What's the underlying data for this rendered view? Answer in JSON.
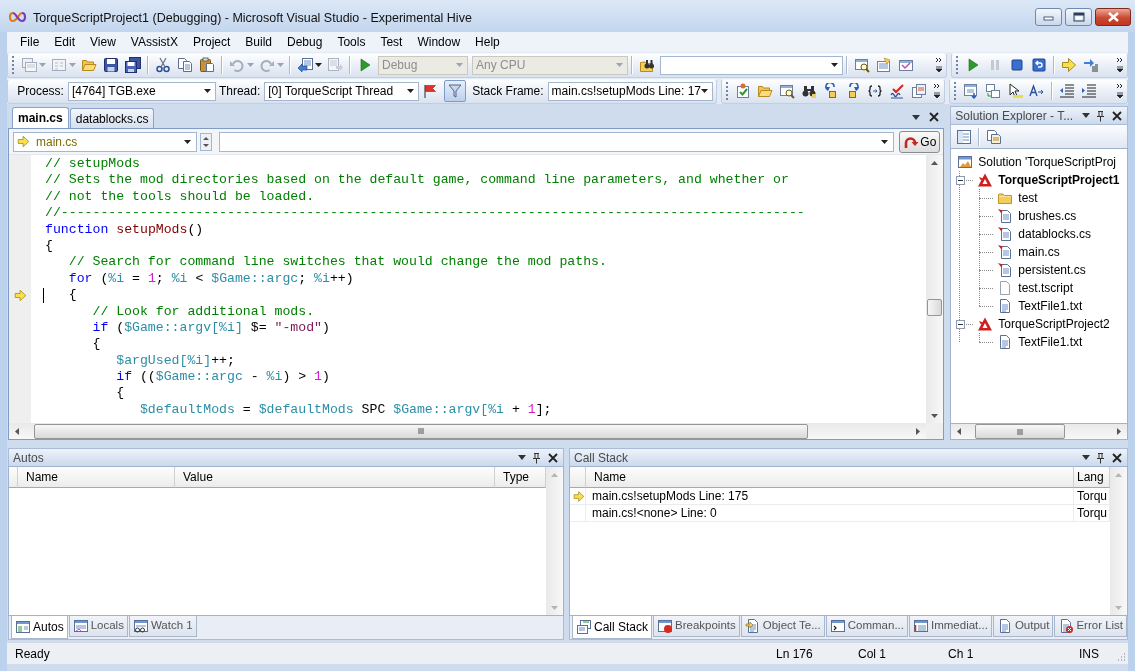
{
  "window": {
    "title": "TorqueScriptProject1 (Debugging) - Microsoft Visual Studio - Experimental Hive"
  },
  "menu": [
    "File",
    "Edit",
    "View",
    "VAssistX",
    "Project",
    "Build",
    "Debug",
    "Tools",
    "Test",
    "Window",
    "Help"
  ],
  "toolbar": {
    "configuration": {
      "value": "Debug",
      "disabled": true
    },
    "platform": {
      "value": "Any CPU",
      "disabled": true
    }
  },
  "debug_location": {
    "process_label": "Process:",
    "process": "[4764] TGB.exe",
    "thread_label": "Thread:",
    "thread": "[0] TorqueScript Thread",
    "filter_pressed": true,
    "stack_frame_label": "Stack Frame:",
    "stack_frame": "main.cs!setupMods Line: 17"
  },
  "document_tabs": [
    {
      "label": "main.cs",
      "selected": true
    },
    {
      "label": "datablocks.cs",
      "selected": false
    }
  ],
  "navigation_bar": {
    "file": "main.cs",
    "go_button": "Go"
  },
  "code": {
    "lines": [
      {
        "current": false,
        "tokens": [
          {
            "kind": "comment",
            "text": "// setupMods"
          }
        ]
      },
      {
        "current": false,
        "tokens": [
          {
            "kind": "comment",
            "text": "// Sets the mod directories based on the default game, command line parameters, and whether or"
          }
        ]
      },
      {
        "current": false,
        "tokens": [
          {
            "kind": "comment",
            "text": "// not the tools should be loaded."
          }
        ]
      },
      {
        "current": false,
        "tokens": [
          {
            "kind": "comment",
            "text": "//----------------------------------------------------------------------------------------------"
          }
        ]
      },
      {
        "current": false,
        "tokens": [
          {
            "kind": "keyword",
            "text": "function"
          },
          {
            "kind": "function",
            "text": " setupMods"
          },
          {
            "kind": "plain",
            "text": "()"
          }
        ]
      },
      {
        "current": false,
        "tokens": [
          {
            "kind": "plain",
            "text": "{"
          }
        ]
      },
      {
        "current": false,
        "tokens": [
          {
            "kind": "comment",
            "text": "   // Search for command line switches that would change the mod paths."
          }
        ]
      },
      {
        "current": false,
        "tokens": [
          {
            "kind": "keyword",
            "text": "   for"
          },
          {
            "kind": "plain",
            "text": " ("
          },
          {
            "kind": "variable",
            "text": "%i"
          },
          {
            "kind": "plain",
            "text": " = "
          },
          {
            "kind": "number",
            "text": "1"
          },
          {
            "kind": "plain",
            "text": "; "
          },
          {
            "kind": "variable",
            "text": "%i"
          },
          {
            "kind": "plain",
            "text": " < "
          },
          {
            "kind": "variable",
            "text": "$Game::argc"
          },
          {
            "kind": "plain",
            "text": "; "
          },
          {
            "kind": "variable",
            "text": "%i"
          },
          {
            "kind": "plain",
            "text": "++)"
          }
        ]
      },
      {
        "current": true,
        "tokens": [
          {
            "kind": "plain",
            "text": "   {"
          }
        ]
      },
      {
        "current": false,
        "tokens": [
          {
            "kind": "comment",
            "text": "      // Look for additional mods."
          }
        ]
      },
      {
        "current": false,
        "tokens": [
          {
            "kind": "keyword",
            "text": "      if"
          },
          {
            "kind": "plain",
            "text": " ("
          },
          {
            "kind": "variable",
            "text": "$Game::argv[%i]"
          },
          {
            "kind": "plain",
            "text": " $= "
          },
          {
            "kind": "string",
            "text": "\"-mod\""
          },
          {
            "kind": "plain",
            "text": ")"
          }
        ]
      },
      {
        "current": false,
        "tokens": [
          {
            "kind": "plain",
            "text": "      {"
          }
        ]
      },
      {
        "current": false,
        "tokens": [
          {
            "kind": "variable",
            "text": "         $argUsed[%i]"
          },
          {
            "kind": "plain",
            "text": "++;"
          }
        ]
      },
      {
        "current": false,
        "tokens": [
          {
            "kind": "keyword",
            "text": "         if"
          },
          {
            "kind": "plain",
            "text": " (("
          },
          {
            "kind": "variable",
            "text": "$Game::argc"
          },
          {
            "kind": "plain",
            "text": " - "
          },
          {
            "kind": "variable",
            "text": "%i"
          },
          {
            "kind": "plain",
            "text": ") > "
          },
          {
            "kind": "number",
            "text": "1"
          },
          {
            "kind": "plain",
            "text": ")"
          }
        ]
      },
      {
        "current": false,
        "tokens": [
          {
            "kind": "plain",
            "text": "         {"
          }
        ]
      },
      {
        "current": false,
        "tokens": [
          {
            "kind": "variable",
            "text": "            $defaultMods"
          },
          {
            "kind": "plain",
            "text": " = "
          },
          {
            "kind": "variable",
            "text": "$defaultMods"
          },
          {
            "kind": "plain",
            "text": " SPC "
          },
          {
            "kind": "variable",
            "text": "$Game::argv[%i"
          },
          {
            "kind": "plain",
            "text": " + "
          },
          {
            "kind": "number",
            "text": "1"
          },
          {
            "kind": "plain",
            "text": "];"
          }
        ]
      }
    ]
  },
  "solution_explorer": {
    "title": "Solution Explorer - T...",
    "tree": [
      {
        "label": "Solution 'TorqueScriptProj",
        "kind": "solution",
        "children": [
          {
            "label": "TorqueScriptProject1",
            "kind": "project",
            "expanded": true,
            "startup": true,
            "children": [
              {
                "label": "test",
                "kind": "folder"
              },
              {
                "label": "brushes.cs",
                "kind": "script"
              },
              {
                "label": "datablocks.cs",
                "kind": "script"
              },
              {
                "label": "main.cs",
                "kind": "script"
              },
              {
                "label": "persistent.cs",
                "kind": "script"
              },
              {
                "label": "test.tscript",
                "kind": "blank"
              },
              {
                "label": "TextFile1.txt",
                "kind": "text"
              }
            ]
          },
          {
            "label": "TorqueScriptProject2",
            "kind": "project",
            "expanded": true,
            "startup": false,
            "children": [
              {
                "label": "TextFile1.txt",
                "kind": "text"
              }
            ]
          }
        ]
      }
    ]
  },
  "autos": {
    "title": "Autos",
    "columns": [
      "Name",
      "Value",
      "Type"
    ],
    "tabs": [
      {
        "label": "Autos",
        "selected": true
      },
      {
        "label": "Locals",
        "selected": false
      },
      {
        "label": "Watch 1",
        "selected": false
      }
    ]
  },
  "call_stack": {
    "title": "Call Stack",
    "columns": [
      "Name",
      "Lang"
    ],
    "rows": [
      {
        "current": true,
        "cells": [
          "main.cs!setupMods Line: 175",
          "Torqu"
        ]
      },
      {
        "current": false,
        "cells": [
          "main.cs!<none> Line: 0",
          "Torqu"
        ]
      }
    ],
    "tabs": [
      {
        "label": "Call Stack",
        "selected": true
      },
      {
        "label": "Breakpoints",
        "selected": false
      },
      {
        "label": "Object Te...",
        "selected": false
      },
      {
        "label": "Comman...",
        "selected": false
      },
      {
        "label": "Immediat...",
        "selected": false
      },
      {
        "label": "Output",
        "selected": false
      },
      {
        "label": "Error List",
        "selected": false
      }
    ]
  },
  "status_bar": {
    "message": "Ready",
    "line": "Ln 176",
    "column": "Col 1",
    "char": "Ch 1",
    "mode": "INS"
  }
}
